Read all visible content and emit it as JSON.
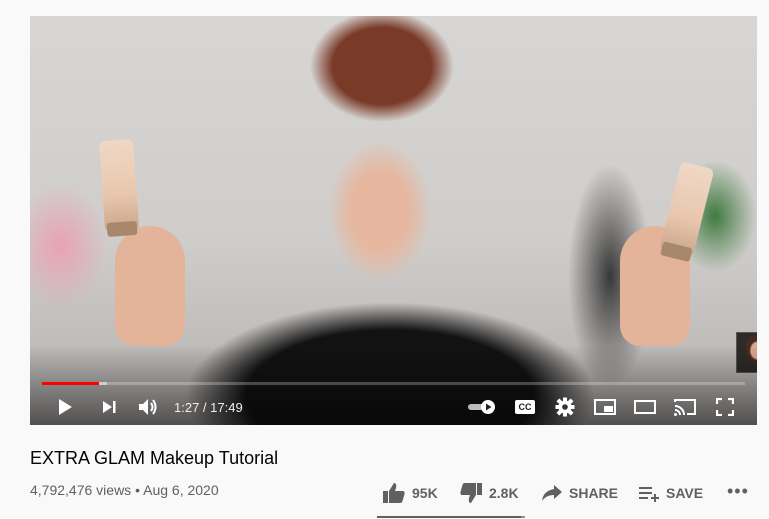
{
  "video": {
    "title": "EXTRA GLAM Makeup Tutorial",
    "views": "4,792,476 views",
    "separator": "•",
    "date": "Aug 6, 2020"
  },
  "player": {
    "time_current": "1:27",
    "time_duration": "17:49",
    "time_separator": " / ",
    "progress_played_fraction": 0.081,
    "progress_loaded_fraction": 0.092,
    "controls": [
      "play-icon",
      "next-icon",
      "volume-icon",
      "autoplay-toggle",
      "cc-icon",
      "settings-icon",
      "miniplayer-icon",
      "theater-icon",
      "cast-icon",
      "fullscreen-icon"
    ],
    "cc_label": "CC"
  },
  "actions": {
    "like": "95K",
    "dislike": "2.8K",
    "share": "SHARE",
    "save": "SAVE",
    "more": "•••",
    "like_fraction": 0.97
  },
  "colors": {
    "progress_red": "#ff0000",
    "secondary_text": "#606060",
    "page_bg": "#f9f9f9"
  }
}
